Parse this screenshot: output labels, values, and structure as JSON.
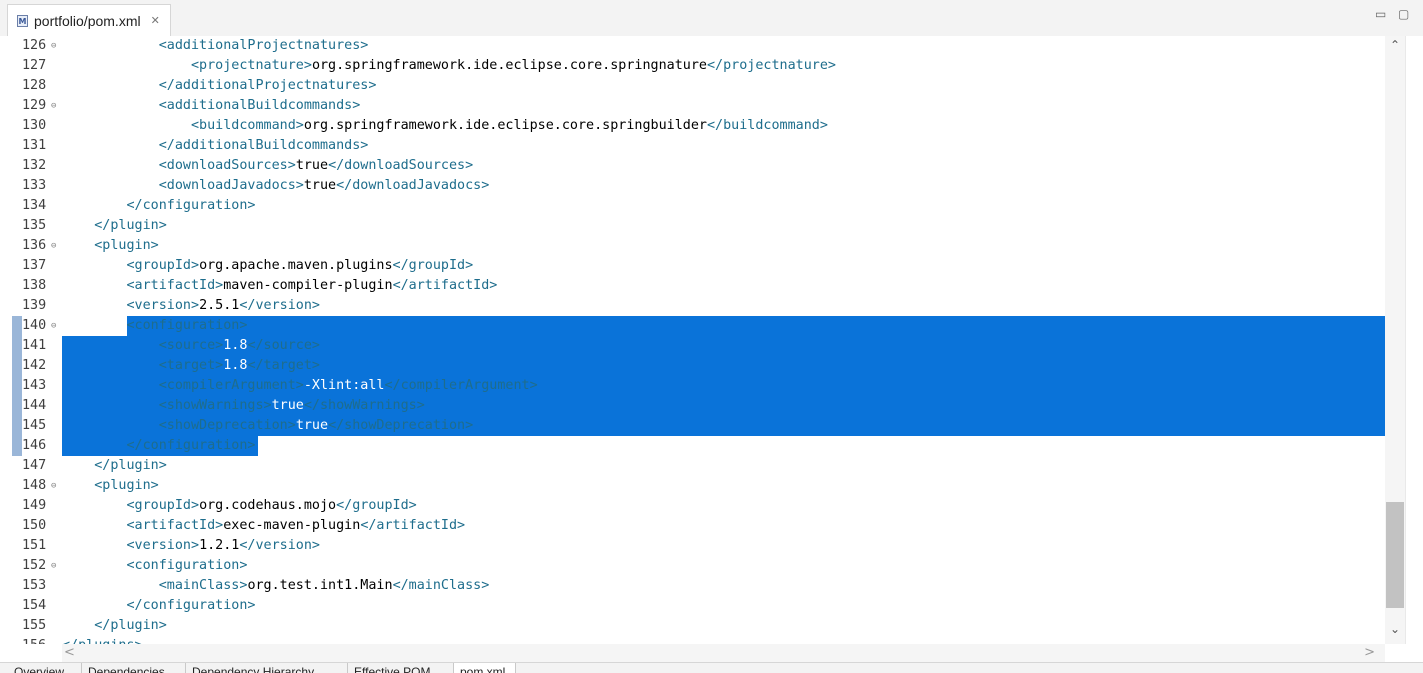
{
  "tab": {
    "title": "portfolio/pom.xml",
    "close": "✕"
  },
  "window_controls": {
    "minimize": "▭",
    "maximize": "▢"
  },
  "lines": [
    {
      "num": "126",
      "fold": "⊖",
      "segs": [
        [
          "            ",
          "x"
        ],
        [
          "<additionalProjectnatures>",
          "t"
        ]
      ]
    },
    {
      "num": "127",
      "fold": "",
      "segs": [
        [
          "                ",
          "x"
        ],
        [
          "<projectnature>",
          "t"
        ],
        [
          "org.springframework.ide.eclipse.core.springnature",
          "x"
        ],
        [
          "</projectnature>",
          "t"
        ]
      ]
    },
    {
      "num": "128",
      "fold": "",
      "segs": [
        [
          "            ",
          "x"
        ],
        [
          "</additionalProjectnatures>",
          "t"
        ]
      ]
    },
    {
      "num": "129",
      "fold": "⊖",
      "segs": [
        [
          "            ",
          "x"
        ],
        [
          "<additionalBuildcommands>",
          "t"
        ]
      ]
    },
    {
      "num": "130",
      "fold": "",
      "segs": [
        [
          "                ",
          "x"
        ],
        [
          "<buildcommand>",
          "t"
        ],
        [
          "org.springframework.ide.eclipse.core.springbuilder",
          "x"
        ],
        [
          "</buildcommand>",
          "t"
        ]
      ]
    },
    {
      "num": "131",
      "fold": "",
      "segs": [
        [
          "            ",
          "x"
        ],
        [
          "</additionalBuildcommands>",
          "t"
        ]
      ]
    },
    {
      "num": "132",
      "fold": "",
      "segs": [
        [
          "            ",
          "x"
        ],
        [
          "<downloadSources>",
          "t"
        ],
        [
          "true",
          "x"
        ],
        [
          "</downloadSources>",
          "t"
        ]
      ]
    },
    {
      "num": "133",
      "fold": "",
      "segs": [
        [
          "            ",
          "x"
        ],
        [
          "<downloadJavadocs>",
          "t"
        ],
        [
          "true",
          "x"
        ],
        [
          "</downloadJavadocs>",
          "t"
        ]
      ]
    },
    {
      "num": "134",
      "fold": "",
      "segs": [
        [
          "        ",
          "x"
        ],
        [
          "</configuration>",
          "t"
        ]
      ]
    },
    {
      "num": "135",
      "fold": "",
      "segs": [
        [
          "    ",
          "x"
        ],
        [
          "</plugin>",
          "t"
        ]
      ]
    },
    {
      "num": "136",
      "fold": "⊖",
      "segs": [
        [
          "    ",
          "x"
        ],
        [
          "<plugin>",
          "t"
        ]
      ]
    },
    {
      "num": "137",
      "fold": "",
      "segs": [
        [
          "        ",
          "x"
        ],
        [
          "<groupId>",
          "t"
        ],
        [
          "org.apache.maven.plugins",
          "x"
        ],
        [
          "</groupId>",
          "t"
        ]
      ]
    },
    {
      "num": "138",
      "fold": "",
      "segs": [
        [
          "        ",
          "x"
        ],
        [
          "<artifactId>",
          "t"
        ],
        [
          "maven-compiler-plugin",
          "x"
        ],
        [
          "</artifactId>",
          "t"
        ]
      ]
    },
    {
      "num": "139",
      "fold": "",
      "segs": [
        [
          "        ",
          "x"
        ],
        [
          "<version>",
          "t"
        ],
        [
          "2.5.1",
          "x"
        ],
        [
          "</version>",
          "t"
        ]
      ]
    },
    {
      "num": "140",
      "fold": "⊖",
      "selected": true,
      "segs": [
        [
          "        ",
          "x"
        ],
        [
          "<configuration>",
          "t"
        ]
      ]
    },
    {
      "num": "141",
      "fold": "",
      "selected": true,
      "segs": [
        [
          "            ",
          "x"
        ],
        [
          "<source>",
          "t"
        ],
        [
          "1.8",
          "x"
        ],
        [
          "</source>",
          "t"
        ]
      ]
    },
    {
      "num": "142",
      "fold": "",
      "selected": true,
      "segs": [
        [
          "            ",
          "x"
        ],
        [
          "<target>",
          "t"
        ],
        [
          "1.8",
          "x"
        ],
        [
          "</target>",
          "t"
        ]
      ]
    },
    {
      "num": "143",
      "fold": "",
      "selected": true,
      "segs": [
        [
          "            ",
          "x"
        ],
        [
          "<compilerArgument>",
          "t"
        ],
        [
          "-Xlint:all",
          "x"
        ],
        [
          "</compilerArgument>",
          "t"
        ]
      ]
    },
    {
      "num": "144",
      "fold": "",
      "selected": true,
      "segs": [
        [
          "            ",
          "x"
        ],
        [
          "<showWarnings>",
          "t"
        ],
        [
          "true",
          "x"
        ],
        [
          "</showWarnings>",
          "t"
        ]
      ]
    },
    {
      "num": "145",
      "fold": "",
      "selected": true,
      "segs": [
        [
          "            ",
          "x"
        ],
        [
          "<showDeprecation>",
          "t"
        ],
        [
          "true",
          "x"
        ],
        [
          "</showDeprecation>",
          "t"
        ]
      ]
    },
    {
      "num": "146",
      "fold": "",
      "selected": true,
      "segs": [
        [
          "        ",
          "x"
        ],
        [
          "</configuration>",
          "t"
        ]
      ]
    },
    {
      "num": "147",
      "fold": "",
      "segs": [
        [
          "    ",
          "x"
        ],
        [
          "</plugin>",
          "t"
        ]
      ]
    },
    {
      "num": "148",
      "fold": "⊖",
      "segs": [
        [
          "    ",
          "x"
        ],
        [
          "<plugin>",
          "t"
        ]
      ]
    },
    {
      "num": "149",
      "fold": "",
      "segs": [
        [
          "        ",
          "x"
        ],
        [
          "<groupId>",
          "t"
        ],
        [
          "org.codehaus.mojo",
          "x"
        ],
        [
          "</groupId>",
          "t"
        ]
      ]
    },
    {
      "num": "150",
      "fold": "",
      "segs": [
        [
          "        ",
          "x"
        ],
        [
          "<artifactId>",
          "t"
        ],
        [
          "exec-maven-plugin",
          "x"
        ],
        [
          "</artifactId>",
          "t"
        ]
      ]
    },
    {
      "num": "151",
      "fold": "",
      "segs": [
        [
          "        ",
          "x"
        ],
        [
          "<version>",
          "t"
        ],
        [
          "1.2.1",
          "x"
        ],
        [
          "</version>",
          "t"
        ]
      ]
    },
    {
      "num": "152",
      "fold": "⊖",
      "segs": [
        [
          "        ",
          "x"
        ],
        [
          "<configuration>",
          "t"
        ]
      ]
    },
    {
      "num": "153",
      "fold": "",
      "segs": [
        [
          "            ",
          "x"
        ],
        [
          "<mainClass>",
          "t"
        ],
        [
          "org.test.int1.Main",
          "x"
        ],
        [
          "</mainClass>",
          "t"
        ]
      ]
    },
    {
      "num": "154",
      "fold": "",
      "segs": [
        [
          "        ",
          "x"
        ],
        [
          "</configuration>",
          "t"
        ]
      ]
    },
    {
      "num": "155",
      "fold": "",
      "segs": [
        [
          "    ",
          "x"
        ],
        [
          "</plugin>",
          "t"
        ]
      ]
    },
    {
      "num": "156",
      "fold": "",
      "segs": [
        [
          "",
          "x"
        ],
        [
          "</plugins>",
          "t"
        ]
      ]
    }
  ],
  "colors": {
    "selection": "#0a73d9",
    "tag": "#1e6d8c",
    "text": "#000000"
  },
  "scrollbar": {
    "up": "⌃",
    "down": "⌄",
    "left": "<",
    "right": ">"
  },
  "bottom_tabs": [
    "Overview",
    "Dependencies",
    "Dependency Hierarchy",
    "Effective POM",
    "pom.xml"
  ]
}
